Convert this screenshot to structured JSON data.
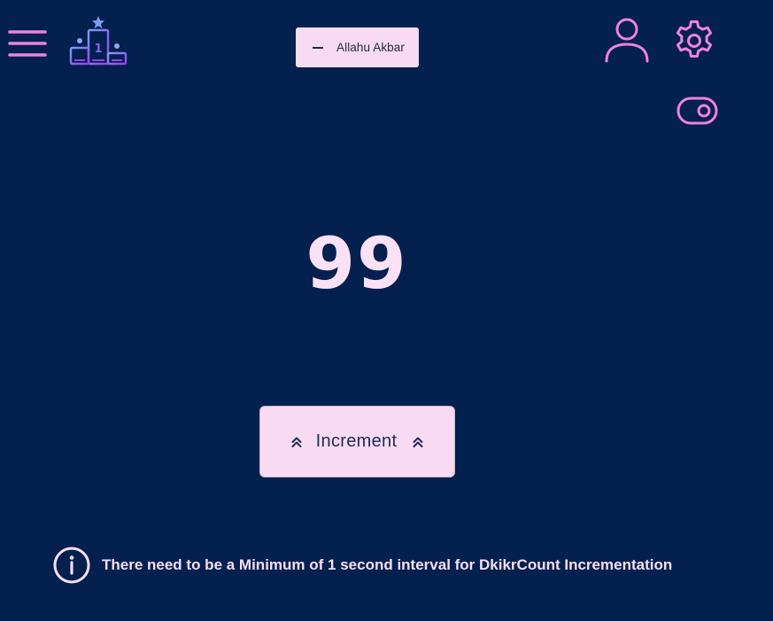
{
  "header": {
    "menu_icon": "hamburger-menu-icon",
    "leaderboard_icon": "podium-leaderboard-icon",
    "leaderboard_rank": "1",
    "dhikr_selector": {
      "icon": "minus-icon",
      "label": "Allahu Akbar"
    },
    "user_icon": "user-profile-icon",
    "settings_icon": "gear-settings-icon",
    "toggle_icon": "toggle-switch-icon"
  },
  "counter": {
    "value": "99"
  },
  "increment_button": {
    "label": "Increment",
    "icon": "double-chevron-up-icon"
  },
  "notice": {
    "icon": "info-circle-icon",
    "text": "There need to be a Minimum of 1 second interval for DkikrCount Incrementation"
  },
  "colors": {
    "background": "#03204f",
    "accent_pink": "#ee82dc",
    "pill_background": "#f8dbf2",
    "counter_text": "#fbe1f5",
    "podium_purple": "#9a4cf0",
    "podium_blue": "#7e9cf5"
  }
}
